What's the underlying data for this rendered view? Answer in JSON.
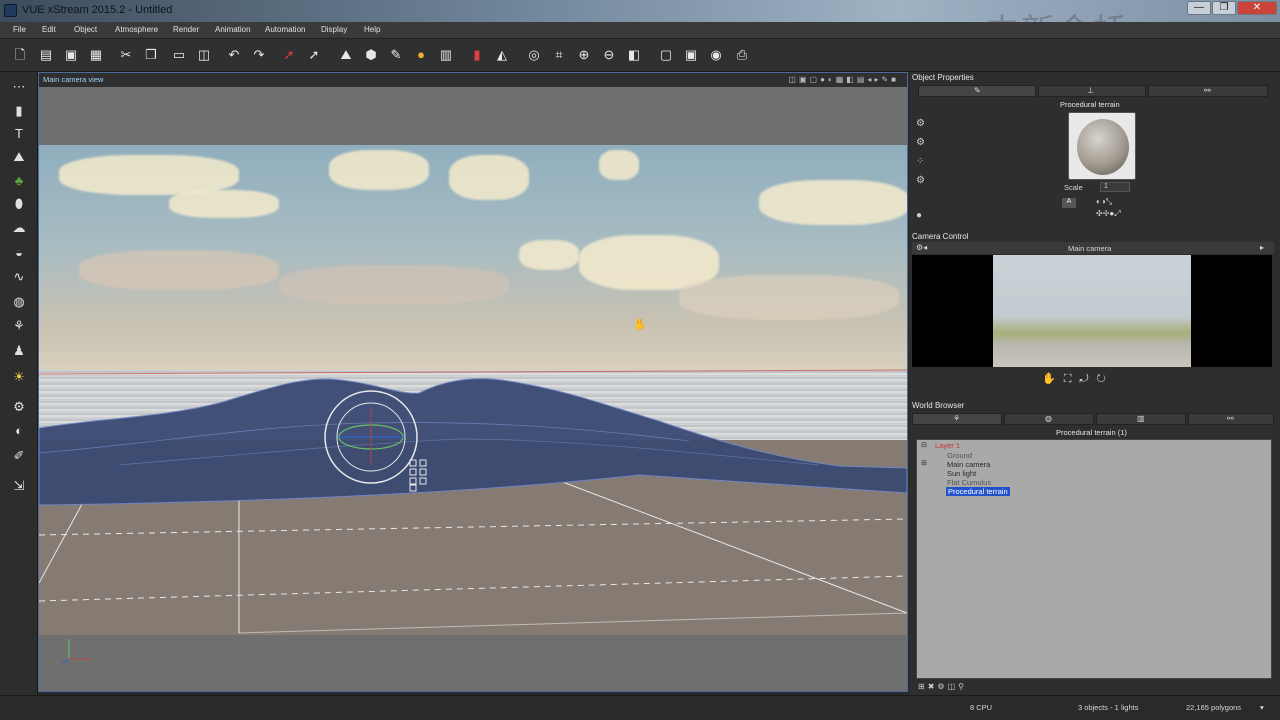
{
  "window": {
    "title": "VUE xStream 2015.2 - Untitled",
    "watermark": "中新金桥"
  },
  "window_controls": {
    "minimize": "—",
    "maximize": "❐",
    "close": "✕"
  },
  "menu": [
    "File",
    "Edit",
    "Object",
    "Atmosphere",
    "Render",
    "Animation",
    "Automation",
    "Display",
    "Help"
  ],
  "viewport": {
    "label": "Main camera view"
  },
  "object_properties": {
    "title": "Object Properties",
    "object_name": "Procedural terrain",
    "scale_label": "Scale",
    "scale_value": "1",
    "material_button": "A"
  },
  "camera_control": {
    "title": "Camera Control",
    "camera_name": "Main camera"
  },
  "world_browser": {
    "title": "World Browser",
    "header": "Procedural terrain (1)",
    "items": [
      {
        "label": "Layer 1"
      },
      {
        "label": "Ground"
      },
      {
        "label": "Main camera"
      },
      {
        "label": "Sun light"
      },
      {
        "label": "Flat Cumulus"
      },
      {
        "label": "Procedural terrain"
      }
    ]
  },
  "status": {
    "cpu": "8 CPU",
    "objects": "3 objects - 1 lights",
    "polygons": "22,165 polygons"
  },
  "colors": {
    "selection": "#2453c9",
    "terrain": "#3b4a73",
    "viewport_border": "#4a6a9a",
    "layer_red": "#d03030"
  }
}
